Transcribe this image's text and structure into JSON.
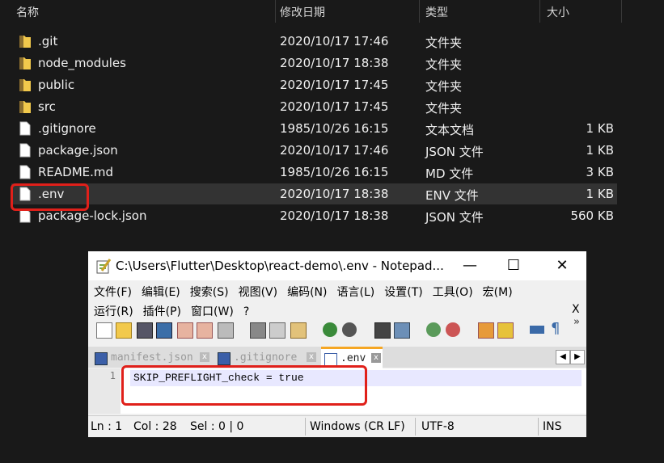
{
  "explorer": {
    "headers": {
      "name": "名称",
      "date": "修改日期",
      "type": "类型",
      "size": "大小"
    },
    "rows": [
      {
        "name": ".git",
        "date": "2020/10/17 17:46",
        "type": "文件夹",
        "size": "",
        "icon": "folder-icon"
      },
      {
        "name": "node_modules",
        "date": "2020/10/17 18:38",
        "type": "文件夹",
        "size": "",
        "icon": "folder-icon"
      },
      {
        "name": "public",
        "date": "2020/10/17 17:45",
        "type": "文件夹",
        "size": "",
        "icon": "folder-icon"
      },
      {
        "name": "src",
        "date": "2020/10/17 17:45",
        "type": "文件夹",
        "size": "",
        "icon": "folder-icon"
      },
      {
        "name": ".gitignore",
        "date": "1985/10/26 16:15",
        "type": "文本文档",
        "size": "1 KB",
        "icon": "file-icon"
      },
      {
        "name": "package.json",
        "date": "2020/10/17 17:46",
        "type": "JSON 文件",
        "size": "1 KB",
        "icon": "file-icon"
      },
      {
        "name": "README.md",
        "date": "1985/10/26 16:15",
        "type": "MD 文件",
        "size": "3 KB",
        "icon": "file-icon"
      },
      {
        "name": ".env",
        "date": "2020/10/17 18:38",
        "type": "ENV 文件",
        "size": "1 KB",
        "icon": "file-icon"
      },
      {
        "name": "package-lock.json",
        "date": "2020/10/17 18:38",
        "type": "JSON 文件",
        "size": "560 KB",
        "icon": "file-icon"
      }
    ]
  },
  "notepad": {
    "title": "C:\\Users\\Flutter\\Desktop\\react-demo\\.env - Notepad...",
    "window_buttons": {
      "minimize": "—",
      "maximize": "☐",
      "close": "✕"
    },
    "menu_row1": [
      "文件(F)",
      "编辑(E)",
      "搜索(S)",
      "视图(V)",
      "编码(N)",
      "语言(L)",
      "设置(T)",
      "工具(O)",
      "宏(M)"
    ],
    "menu_row2": [
      "运行(R)",
      "插件(P)",
      "窗口(W)",
      "?"
    ],
    "menu_close": "X",
    "tabs": [
      {
        "label": "manifest.json",
        "active": false
      },
      {
        "label": ".gitignore",
        "active": false
      },
      {
        "label": ".env",
        "active": true
      }
    ],
    "tab_close": "x",
    "line_number": "1",
    "code_line": "SKIP_PREFLIGHT_check = true",
    "status": {
      "ln": "Ln : 1",
      "col": "Col : 28",
      "sel": "Sel : 0 | 0",
      "eol": "Windows (CR LF)",
      "encoding": "UTF-8",
      "mode": "INS"
    }
  },
  "colors": {
    "highlight_red": "#e0201a",
    "folder_yellow": "#f2c94c",
    "active_tab_accent": "#f5a623"
  }
}
